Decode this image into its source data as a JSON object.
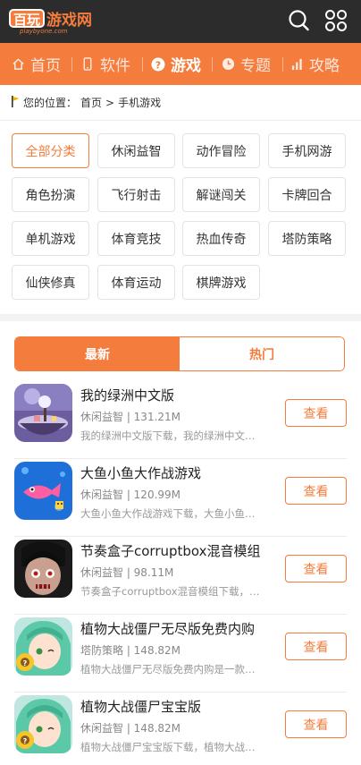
{
  "header": {
    "logo_badge": "百玩",
    "logo_text": "游戏网",
    "logo_sub": "playbyone.com"
  },
  "nav": {
    "items": [
      {
        "label": "首页",
        "icon": "home-icon"
      },
      {
        "label": "软件",
        "icon": "phone-icon"
      },
      {
        "label": "游戏",
        "icon": "question-icon",
        "active": true
      },
      {
        "label": "专题",
        "icon": "clock-icon"
      },
      {
        "label": "攻略",
        "icon": "bar-chart-icon"
      }
    ]
  },
  "breadcrumb": {
    "prefix": "您的位置：",
    "home": "首页",
    "sep": ">",
    "current": "手机游戏"
  },
  "categories": [
    "全部分类",
    "休闲益智",
    "动作冒险",
    "手机网游",
    "角色扮演",
    "飞行射击",
    "解谜闯关",
    "卡牌回合",
    "单机游戏",
    "体育竞技",
    "热血传奇",
    "塔防策略",
    "仙侠修真",
    "体育运动",
    "棋牌游戏"
  ],
  "tabs": {
    "latest": "最新",
    "hot": "热门"
  },
  "games": [
    {
      "title": "我的绿洲中文版",
      "meta": "休闲益智 | 131.21M",
      "desc": "我的绿洲中文版下载，我的绿洲中文版是一款",
      "button": "查看"
    },
    {
      "title": "大鱼小鱼大作战游戏",
      "meta": "休闲益智 | 120.99M",
      "desc": "大鱼小鱼大作战游戏下载，大鱼小鱼大作战",
      "button": "查看"
    },
    {
      "title": "节奏盒子corruptbox混音模组",
      "meta": "休闲益智 | 98.11M",
      "desc": "节奏盒子corruptbox混音模组下载，节奏盒子",
      "button": "查看"
    },
    {
      "title": "植物大战僵尸无尽版免费内购",
      "meta": "塔防策略 | 148.82M",
      "desc": "植物大战僵尸无尽版免费内购是一款植物大战",
      "button": "查看"
    },
    {
      "title": "植物大战僵尸宝宝版",
      "meta": "休闲益智 | 148.82M",
      "desc": "植物大战僵尸宝宝版下载，植物大战僵尸宝宝版",
      "button": "查看"
    }
  ],
  "colors": {
    "accent": "#f47c3c",
    "topbar": "#2c2c2c"
  }
}
